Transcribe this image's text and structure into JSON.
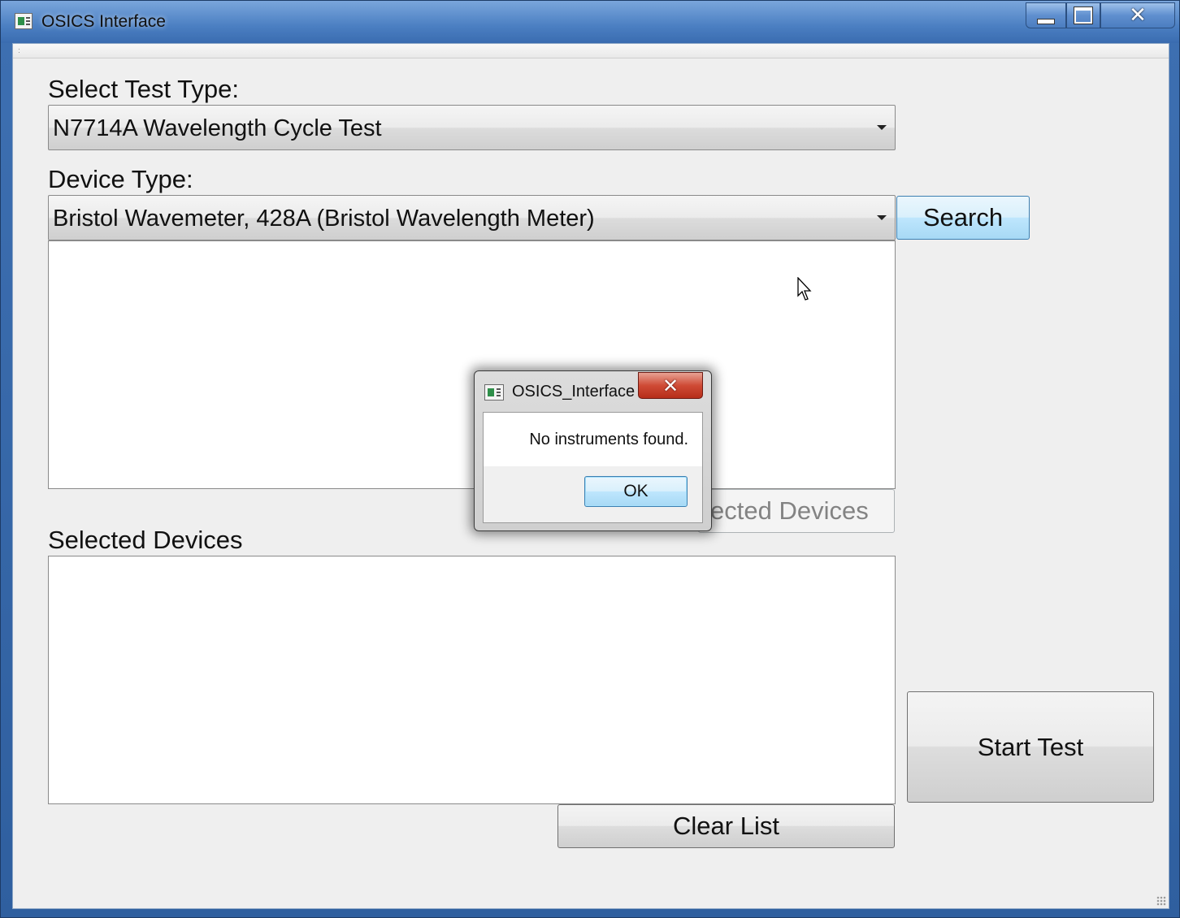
{
  "window": {
    "title": "OSICS Interface",
    "icon": "app-window-icon",
    "controls": [
      "minimize-icon",
      "maximize-icon",
      "close-icon"
    ]
  },
  "form": {
    "test_type_label": "Select Test Type:",
    "test_type_value": "N7714A Wavelength Cycle Test",
    "device_type_label": "Device Type:",
    "device_type_value": "Bristol Wavemeter, 428A (Bristol Wavelength Meter)",
    "search_label": "Search",
    "add_selected_partial": "ected Devices",
    "selected_devices_label": "Selected Devices",
    "clear_list_label": "Clear List",
    "start_test_label": "Start Test"
  },
  "dialog": {
    "title": "OSICS_Interface",
    "message": "No instruments found.",
    "ok_label": "OK",
    "close_glyph": "✕"
  }
}
